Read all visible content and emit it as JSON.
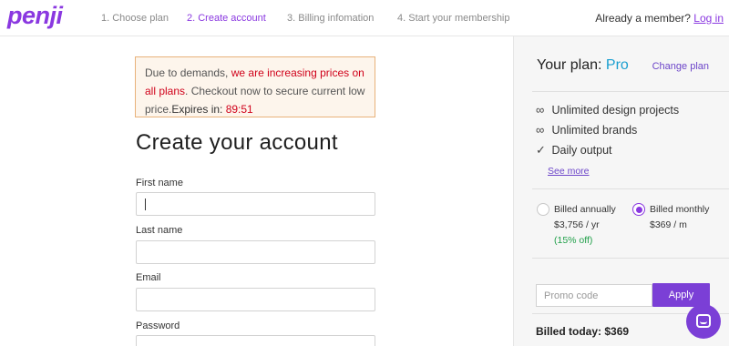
{
  "header": {
    "logo": "penji",
    "steps": [
      "1. Choose plan",
      "2. Create account",
      "3. Billing infomation",
      "4. Start your membership"
    ],
    "member_text": "Already a member?",
    "login_label": "Log in"
  },
  "notice": {
    "part1": "Due to demands, ",
    "part2": "we are increasing prices on all plans",
    "part3": ". Checkout now to secure current low price.",
    "expires_label": "Expires in: ",
    "timer": "89:51"
  },
  "form": {
    "title": "Create your account",
    "fields": [
      {
        "label": "First name",
        "value": ""
      },
      {
        "label": "Last name",
        "value": ""
      },
      {
        "label": "Email",
        "value": ""
      },
      {
        "label": "Password",
        "value": ""
      }
    ]
  },
  "sidebar": {
    "plan_label": "Your plan: ",
    "plan_name": "Pro",
    "change_plan": "Change plan",
    "features": [
      {
        "icon": "infinity-icon",
        "glyph": "∞",
        "text": "Unlimited design projects"
      },
      {
        "icon": "infinity-icon",
        "glyph": "∞",
        "text": "Unlimited brands"
      },
      {
        "icon": "check-icon",
        "glyph": "✓",
        "text": "Daily output"
      }
    ],
    "see_more": "See more",
    "billing": {
      "annual": {
        "label": "Billed annually",
        "price": "$3,756 / yr",
        "discount": "(15% off)",
        "selected": false
      },
      "monthly": {
        "label": "Billed monthly",
        "price": "$369 / m",
        "selected": true
      }
    },
    "promo_placeholder": "Promo code",
    "apply_label": "Apply",
    "billed_today": "Billed today: $369"
  },
  "colors": {
    "brand": "#8a38e0",
    "button": "#7b3fd6",
    "plan_accent": "#1a9fd0",
    "alert_red": "#d0021b",
    "discount_green": "#21a04a"
  }
}
